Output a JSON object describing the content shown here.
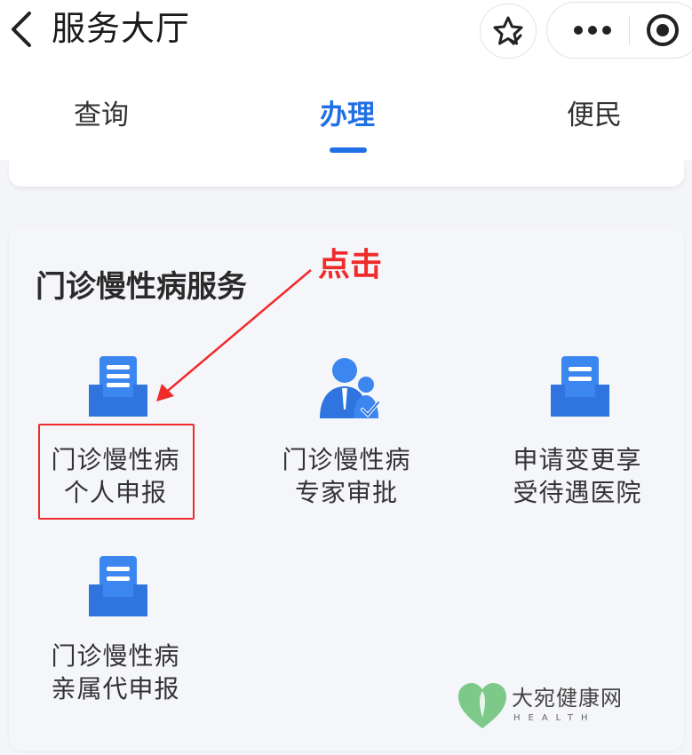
{
  "header": {
    "title": "服务大厅",
    "back_icon": "chevron-left-icon",
    "favorite_icon": "star-icon",
    "more_icon": "more-dots-icon",
    "home_icon": "target-icon"
  },
  "tabs": [
    {
      "label": "查询",
      "active": false
    },
    {
      "label": "办理",
      "active": true
    },
    {
      "label": "便民",
      "active": false
    }
  ],
  "section": {
    "title": "门诊慢性病服务",
    "items": [
      {
        "line1": "门诊慢性病",
        "line2": "个人申报",
        "icon": "document-tray-icon"
      },
      {
        "line1": "门诊慢性病",
        "line2": "专家审批",
        "icon": "expert-approval-icon"
      },
      {
        "line1": "申请变更享",
        "line2": "受待遇医院",
        "icon": "document-tray-icon"
      },
      {
        "line1": "门诊慢性病",
        "line2": "亲属代申报",
        "icon": "document-tray-icon"
      }
    ]
  },
  "annotation": {
    "text": "点击",
    "color": "#ef2b2b"
  },
  "watermark": {
    "name": "大宛健康网",
    "subtitle": "HEALTH"
  },
  "colors": {
    "accent": "#1f6fe5",
    "icon_blue": "#3b86ef"
  }
}
